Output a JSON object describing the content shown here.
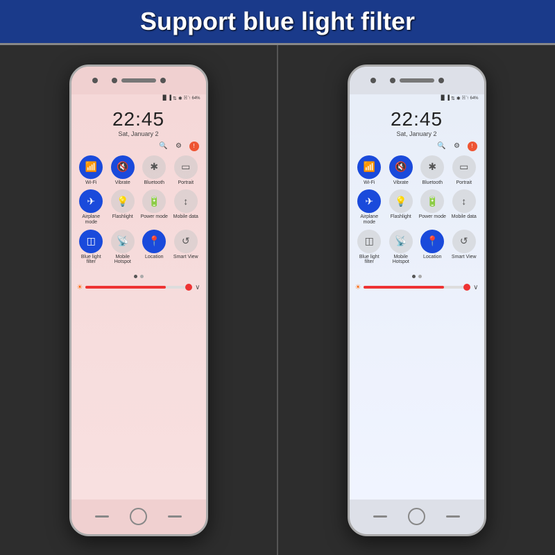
{
  "header": {
    "title": "Support blue light filter"
  },
  "phone_left": {
    "tint": "normal",
    "status": "☵ ᷾↑ 64%",
    "clock": "22:45",
    "date": "Sat, January 2",
    "rows": [
      [
        {
          "label": "Wi-Fi",
          "active": true,
          "icon": "📶"
        },
        {
          "label": "Vibrate",
          "active": true,
          "icon": "🔇"
        },
        {
          "label": "Bluetooth",
          "active": false,
          "icon": "✱"
        },
        {
          "label": "Portrait",
          "active": false,
          "icon": "▭"
        }
      ],
      [
        {
          "label": "Airplane mode",
          "active": true,
          "icon": "✈"
        },
        {
          "label": "Flashlight",
          "active": false,
          "icon": "🔦"
        },
        {
          "label": "Power mode",
          "active": false,
          "icon": "🔋"
        },
        {
          "label": "Mobile data",
          "active": false,
          "icon": "↕"
        }
      ],
      [
        {
          "label": "Blue light filter",
          "active": true,
          "icon": "◫"
        },
        {
          "label": "Mobile Hotspot",
          "active": false,
          "icon": "📡"
        },
        {
          "label": "Location",
          "active": true,
          "icon": "📍"
        },
        {
          "label": "Smart View",
          "active": false,
          "icon": "↺"
        }
      ]
    ]
  },
  "phone_right": {
    "tint": "cool",
    "status": "☵ ᷾↑ 64%",
    "clock": "22:45",
    "date": "Sat, January 2",
    "rows": [
      [
        {
          "label": "Wi-Fi",
          "active": true,
          "icon": "📶"
        },
        {
          "label": "Vibrate",
          "active": true,
          "icon": "🔇"
        },
        {
          "label": "Bluetooth",
          "active": false,
          "icon": "✱"
        },
        {
          "label": "Portrait",
          "active": false,
          "icon": "▭"
        }
      ],
      [
        {
          "label": "Airplane mode",
          "active": true,
          "icon": "✈"
        },
        {
          "label": "Flashlight",
          "active": false,
          "icon": "🔦"
        },
        {
          "label": "Power mode",
          "active": false,
          "icon": "🔋"
        },
        {
          "label": "Mobile data",
          "active": false,
          "icon": "↕"
        }
      ],
      [
        {
          "label": "Blue light filter",
          "active": false,
          "icon": "◫"
        },
        {
          "label": "Mobile Hotspot",
          "active": false,
          "icon": "📡"
        },
        {
          "label": "Location",
          "active": true,
          "icon": "📍"
        },
        {
          "label": "Smart View",
          "active": false,
          "icon": "↺"
        }
      ]
    ]
  },
  "pagination": {
    "dots": [
      true,
      false
    ]
  },
  "brightness": {
    "fill_percent": 75
  }
}
